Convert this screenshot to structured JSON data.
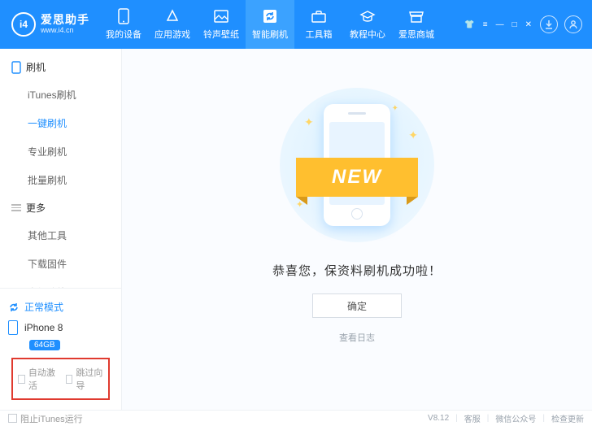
{
  "app": {
    "name": "爱思助手",
    "url": "www.i4.cn",
    "logo_letters": "i4",
    "version": "V8.12"
  },
  "header": {
    "tabs": [
      {
        "label": "我的设备"
      },
      {
        "label": "应用游戏"
      },
      {
        "label": "铃声壁纸"
      },
      {
        "label": "智能刷机",
        "active": true
      },
      {
        "label": "工具箱"
      },
      {
        "label": "教程中心"
      },
      {
        "label": "爱思商城"
      }
    ]
  },
  "sidebar": {
    "group1": {
      "title": "刷机",
      "items": [
        "iTunes刷机",
        "一键刷机",
        "专业刷机",
        "批量刷机"
      ],
      "selected": 1
    },
    "group2": {
      "title": "更多",
      "items": [
        "其他工具",
        "下载固件",
        "高级功能"
      ]
    },
    "mode": "正常模式",
    "device": {
      "name": "iPhone 8",
      "storage": "64GB"
    },
    "options": {
      "auto_activate": "自动激活",
      "skip_guide": "跳过向导"
    }
  },
  "main": {
    "ribbon": "NEW",
    "message": "恭喜您，保资料刷机成功啦！",
    "ok": "确定",
    "view_log": "查看日志"
  },
  "status": {
    "block_itunes": "阻止iTunes运行",
    "support": "客服",
    "wechat": "微信公众号",
    "update": "检查更新"
  }
}
